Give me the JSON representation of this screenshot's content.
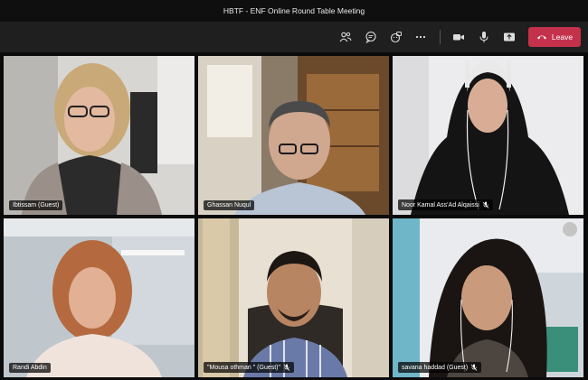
{
  "window": {
    "title": "HBTF - ENF Online Round Table Meeting"
  },
  "toolbar": {
    "buttons": [
      {
        "icon": "participants-icon"
      },
      {
        "icon": "chat-icon"
      },
      {
        "icon": "reactions-icon"
      },
      {
        "icon": "more-options-icon"
      },
      {
        "icon": "camera-icon"
      },
      {
        "icon": "microphone-icon"
      },
      {
        "icon": "share-screen-icon"
      }
    ],
    "leave_label": "Leave"
  },
  "participants": [
    {
      "name": "Ibtissam (Guest)",
      "muted": false
    },
    {
      "name": "Ghassan Nuqul",
      "muted": false
    },
    {
      "name": "Noor Kamal Ass'Ad Alqaissi",
      "muted": true,
      "active_speaker": true
    },
    {
      "name": "Randi Abdin",
      "muted": false
    },
    {
      "name": "\"Mousa othman \" (Guest)\"",
      "muted": true
    },
    {
      "name": "savana haddad (Guest)",
      "muted": true
    }
  ],
  "colors": {
    "leave": "#c4314b",
    "active_outline": "#8b8ee8",
    "toolbar": "#1f1f1f"
  }
}
